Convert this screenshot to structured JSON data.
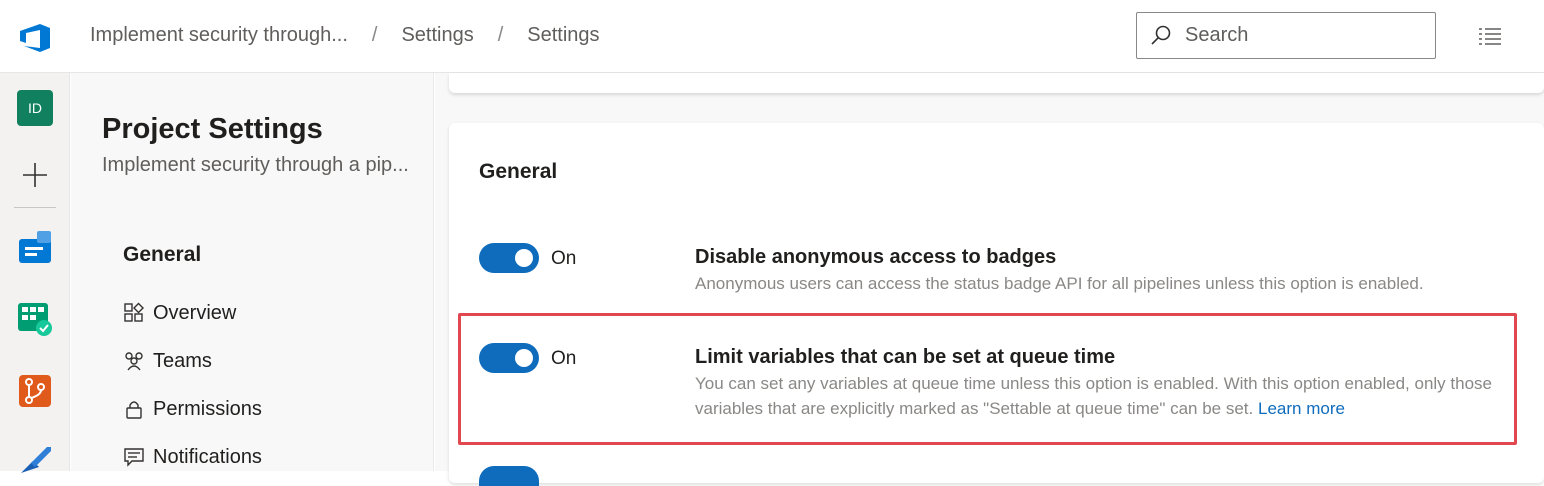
{
  "breadcrumbs": [
    "Implement security through...",
    "Settings",
    "Settings"
  ],
  "breadcrumb_separator": "/",
  "search": {
    "placeholder": "Search"
  },
  "rail": {
    "project_initials": "ID"
  },
  "settings_nav": {
    "title": "Project Settings",
    "subtitle": "Implement security through a pip...",
    "group_label": "General",
    "items": [
      {
        "label": "Overview",
        "icon": "overview-icon"
      },
      {
        "label": "Teams",
        "icon": "teams-icon"
      },
      {
        "label": "Permissions",
        "icon": "lock-icon"
      },
      {
        "label": "Notifications",
        "icon": "notifications-icon"
      }
    ]
  },
  "main": {
    "section_title": "General",
    "options": [
      {
        "toggle_state": "On",
        "title": "Disable anonymous access to badges",
        "description": "Anonymous users can access the status badge API for all pipelines unless this option is enabled."
      },
      {
        "toggle_state": "On",
        "title": "Limit variables that can be set at queue time",
        "description": "You can set any variables at queue time unless this option is enabled. With this option enabled, only those variables that are explicitly marked as \"Settable at queue time\" can be set.",
        "link": "Learn more"
      }
    ]
  },
  "colors": {
    "accent": "#0f6cbd",
    "highlight": "#e0474f",
    "avatar": "#10805f"
  }
}
